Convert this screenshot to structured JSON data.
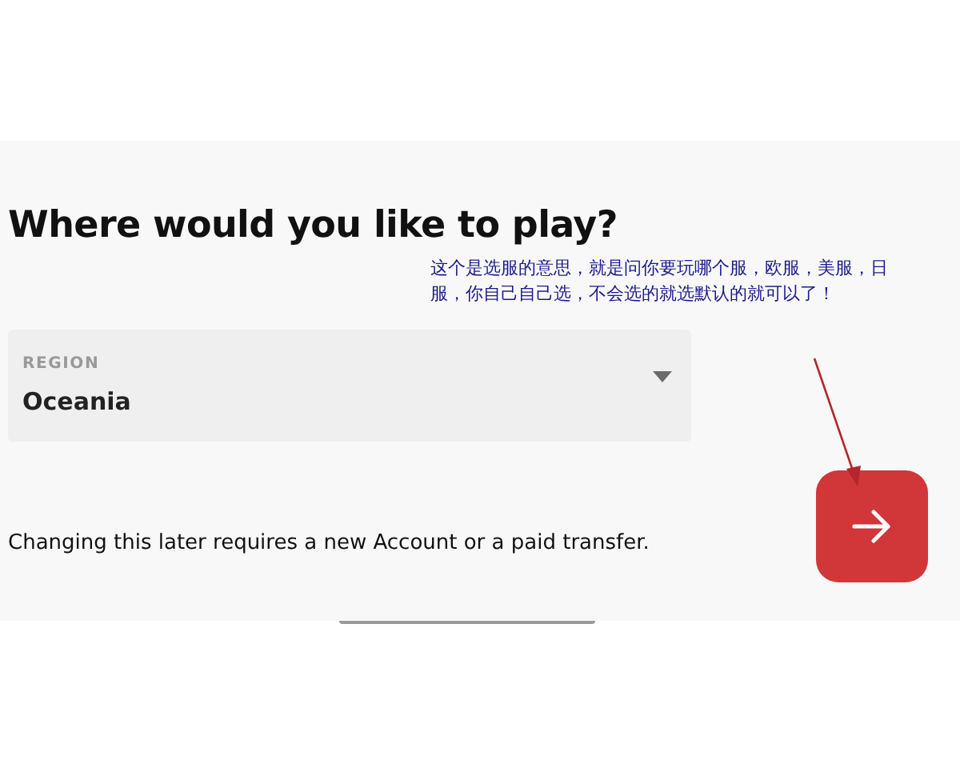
{
  "heading": "Where would you like to play?",
  "annotation": {
    "text": "这个是选服的意思，就是问你要玩哪个服，欧服，美服，日服，你自己自己选，不会选的就选默认的就可以了！"
  },
  "region": {
    "label": "REGION",
    "value": "Oceania"
  },
  "note": "Changing this later requires a new Account or a paid transfer."
}
